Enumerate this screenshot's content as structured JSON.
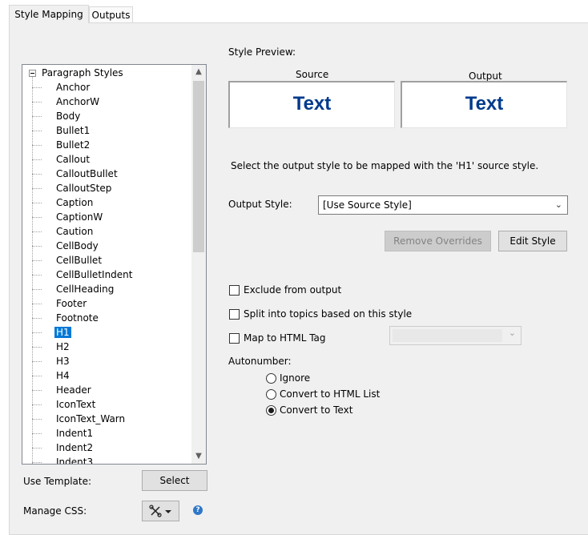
{
  "tabs": [
    {
      "label": "Style Mapping",
      "active": true
    },
    {
      "label": "Outputs",
      "active": false
    }
  ],
  "tree": {
    "root_label": "Paragraph Styles",
    "selected": "H1",
    "items": [
      "Anchor",
      "AnchorW",
      "Body",
      "Bullet1",
      "Bullet2",
      "Callout",
      "CalloutBullet",
      "CalloutStep",
      "Caption",
      "CaptionW",
      "Caution",
      "CellBody",
      "CellBullet",
      "CellBulletIndent",
      "CellHeading",
      "Footer",
      "Footnote",
      "H1",
      "H2",
      "H3",
      "H4",
      "Header",
      "IconText",
      "IconText_Warn",
      "Indent1",
      "Indent2",
      "Indent3"
    ]
  },
  "preview": {
    "heading": "Style Preview:",
    "source_label": "Source",
    "output_label": "Output",
    "source_text": "Text",
    "output_text": "Text",
    "text_color": "#003a8c"
  },
  "instruction": "Select the output style to be mapped with the 'H1' source style.",
  "output_style": {
    "label": "Output Style:",
    "value": "[Use Source Style]"
  },
  "buttons": {
    "remove_overrides": "Remove Overrides",
    "edit_style": "Edit Style",
    "select": "Select"
  },
  "options": {
    "exclude": "Exclude from output",
    "split": "Split into topics based on this style",
    "map_html": "Map to HTML Tag"
  },
  "autonumber": {
    "label": "Autonumber:",
    "ignore": "Ignore",
    "convert_list": "Convert to HTML List",
    "convert_text": "Convert to Text",
    "selected": "Convert to Text"
  },
  "bottom": {
    "use_template": "Use Template:",
    "manage_css": "Manage CSS:",
    "help": "?"
  }
}
